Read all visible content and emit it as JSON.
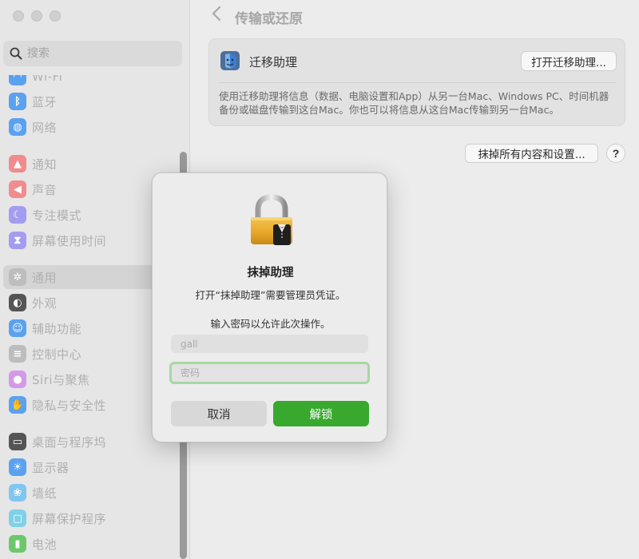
{
  "window": {
    "title": "传输或还原"
  },
  "sidebar": {
    "search_placeholder": "搜索",
    "items": [
      {
        "label": "Wi-Fi",
        "icon": "wifi-icon",
        "color": "#5aa2f0"
      },
      {
        "label": "蓝牙",
        "icon": "bluetooth-icon",
        "color": "#5aa2f0"
      },
      {
        "label": "网络",
        "icon": "globe-icon",
        "color": "#5aa2f0"
      },
      {
        "label": "通知",
        "icon": "bell-icon",
        "color": "#f08c8c"
      },
      {
        "label": "声音",
        "icon": "speaker-icon",
        "color": "#f08c8c"
      },
      {
        "label": "专注模式",
        "icon": "moon-icon",
        "color": "#a49cf0"
      },
      {
        "label": "屏幕使用时间",
        "icon": "hourglass-icon",
        "color": "#a49cf0"
      },
      {
        "label": "通用",
        "icon": "gear-icon",
        "color": "#bdbdbd",
        "active": true
      },
      {
        "label": "外观",
        "icon": "appearance-icon",
        "color": "#555555"
      },
      {
        "label": "辅助功能",
        "icon": "accessibility-icon",
        "color": "#5aa2f0"
      },
      {
        "label": "控制中心",
        "icon": "control-center-icon",
        "color": "#bdbdbd"
      },
      {
        "label": "Siri与聚焦",
        "icon": "siri-icon",
        "color": "#d49ae8"
      },
      {
        "label": "隐私与安全性",
        "icon": "hand-icon",
        "color": "#5aa2f0"
      },
      {
        "label": "桌面与程序坞",
        "icon": "dock-icon",
        "color": "#555555"
      },
      {
        "label": "显示器",
        "icon": "sun-icon",
        "color": "#5aa2f0"
      },
      {
        "label": "墙纸",
        "icon": "flower-icon",
        "color": "#7fc6f0"
      },
      {
        "label": "屏幕保护程序",
        "icon": "screensaver-icon",
        "color": "#7fd0e8"
      },
      {
        "label": "电池",
        "icon": "battery-icon",
        "color": "#6cc86a"
      }
    ]
  },
  "main": {
    "migration": {
      "title": "迁移助理",
      "button": "打开迁移助理...",
      "description": "使用迁移助理将信息（数据、电脑设置和App）从另一台Mac、Windows PC、时间机器备份或磁盘传输到这台Mac。你也可以将信息从这台Mac传输到另一台Mac。"
    },
    "erase_button": "抹掉所有内容和设置...",
    "help_button": "?"
  },
  "dialog": {
    "title": "抹掉助理",
    "message": "打开“抹掉助理”需要管理员凭证。",
    "prompt": "输入密码以允许此次操作。",
    "username_value": "gall",
    "password_placeholder": "密码",
    "cancel_label": "取消",
    "unlock_label": "解锁",
    "unlock_color": "#38a92e"
  }
}
